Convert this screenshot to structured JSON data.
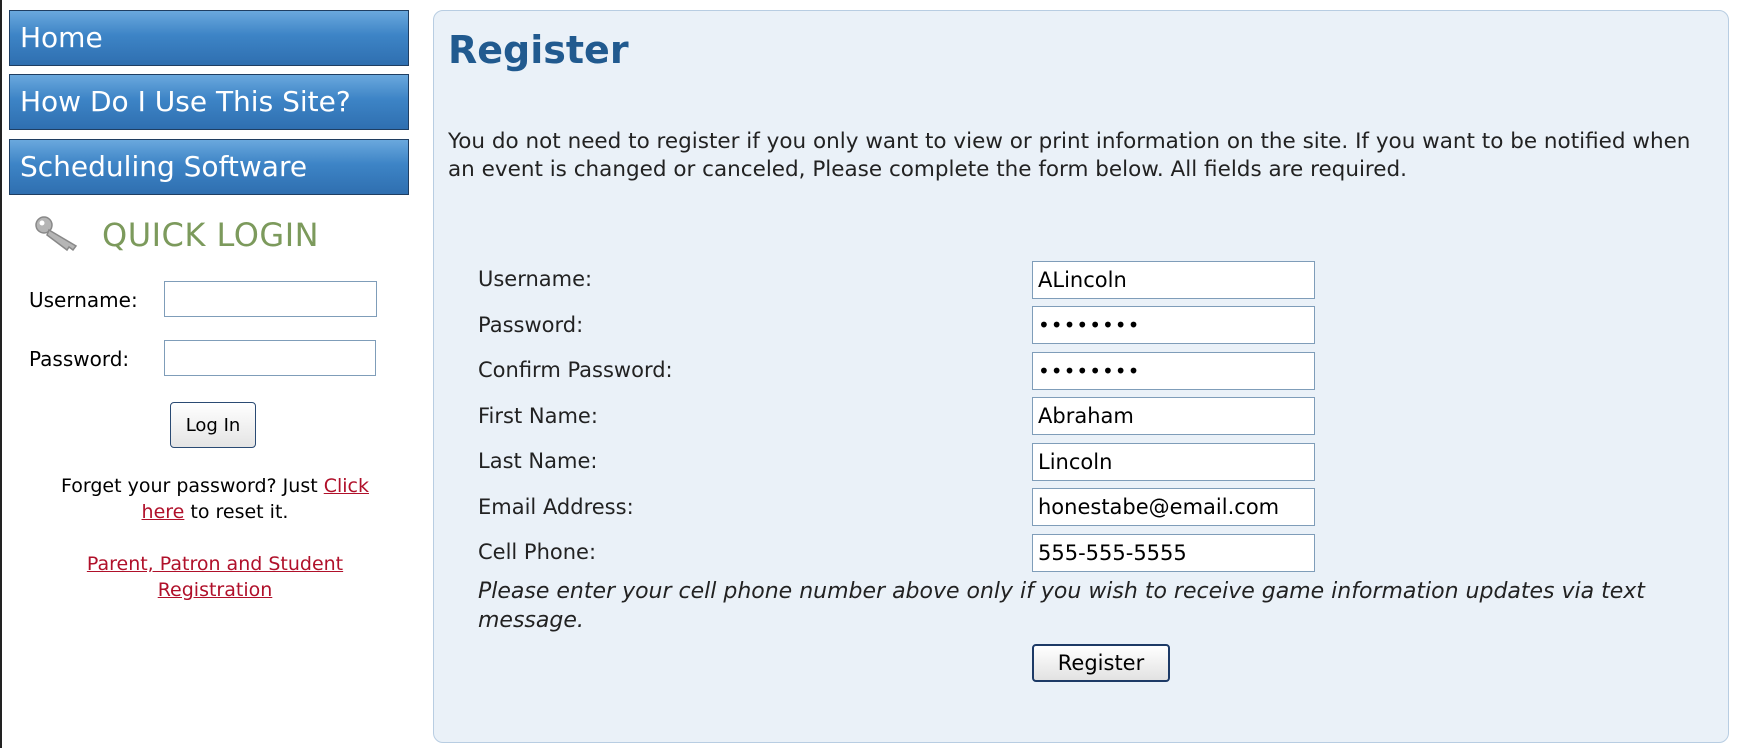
{
  "sidebar": {
    "nav": [
      {
        "label": "Home"
      },
      {
        "label": "How Do I Use This Site?"
      },
      {
        "label": "Scheduling Software"
      }
    ],
    "quick_login": {
      "title": "QUICK LOGIN",
      "icon": "key-icon",
      "username_label": "Username:",
      "username_value": "",
      "password_label": "Password:",
      "password_value": "",
      "login_button": "Log In",
      "forgot_prefix": "Forget your password? Just ",
      "forgot_link_1": "Click",
      "forgot_link_2": "here",
      "forgot_suffix": " to reset it.",
      "registration_link_1": "Parent, Patron and Student",
      "registration_link_2": "Registration"
    }
  },
  "main": {
    "title": "Register",
    "intro": "You do not need to register if you only want to view or print information on the site. If you want to be notified when an event is changed or canceled, Please complete the form below. All fields are required.",
    "fields": [
      {
        "label": "Username:",
        "value": "ALincoln"
      },
      {
        "label": "Password:",
        "value": "••••••••"
      },
      {
        "label": "Confirm Password:",
        "value": "••••••••"
      },
      {
        "label": "First Name:",
        "value": "Abraham"
      },
      {
        "label": "Last Name:",
        "value": "Lincoln"
      },
      {
        "label": "Email Address:",
        "value": "honestabe@email.com"
      },
      {
        "label": "Cell Phone:",
        "value": "555-555-5555"
      }
    ],
    "cell_note": "Please enter your cell phone number above only if you wish to receive game information updates via text message.",
    "register_button": "Register"
  },
  "colors": {
    "nav_blue": "#3d84c6",
    "title_blue": "#215a8f",
    "quick_login_green": "#7c9a5c",
    "link_red": "#b0102a",
    "panel_bg": "#eaf1f8"
  }
}
